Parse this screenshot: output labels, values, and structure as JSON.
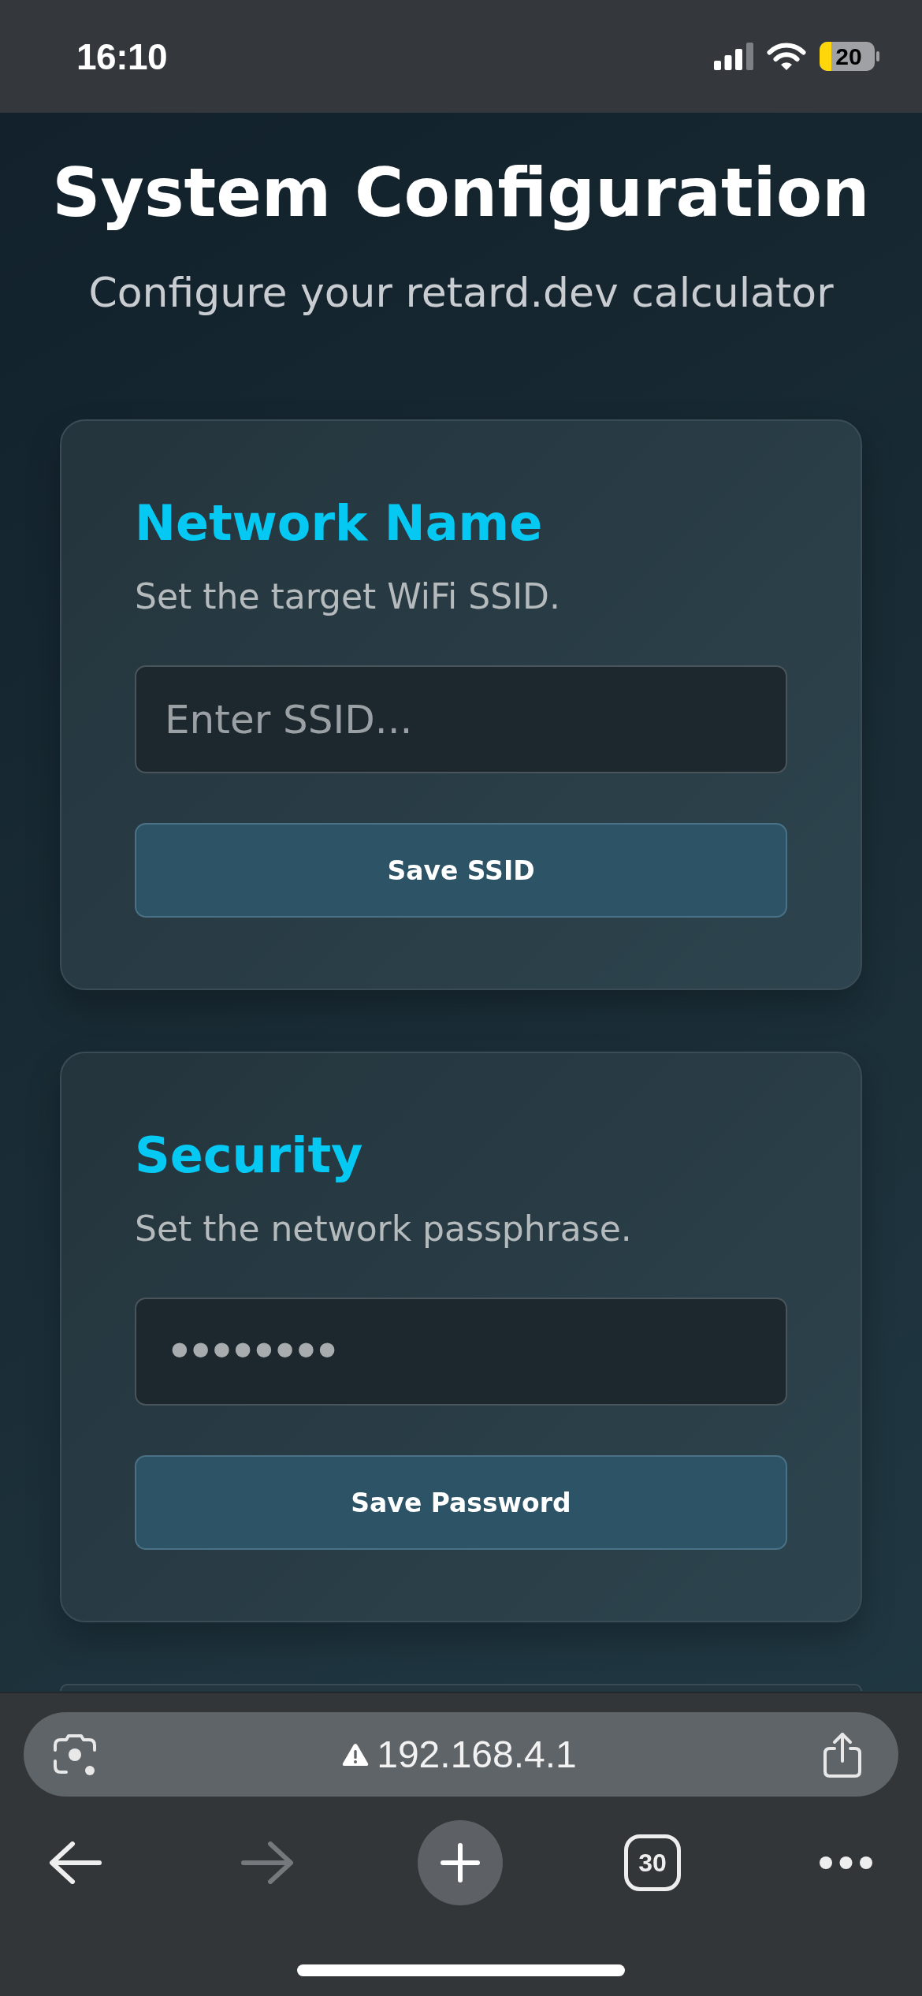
{
  "status_bar": {
    "time": "16:10",
    "battery": "20"
  },
  "header": {
    "title": "System Configuration",
    "subtitle": "Configure your retard.dev calculator"
  },
  "cards": [
    {
      "heading": "Network Name",
      "description": "Set the target WiFi SSID.",
      "field": {
        "kind": "text",
        "placeholder": "Enter SSID..."
      },
      "button": "Save SSID"
    },
    {
      "heading": "Security",
      "description": "Set the network passphrase.",
      "field": {
        "kind": "password",
        "value": "••••••••"
      },
      "button": "Save Password"
    }
  ],
  "browser": {
    "address": "192.168.4.1",
    "toolbar": [
      {
        "kind": "back",
        "disabled": false
      },
      {
        "kind": "forward",
        "disabled": true
      },
      {
        "kind": "new_tab",
        "disabled": false
      },
      {
        "kind": "tabs",
        "label": "30",
        "disabled": false
      },
      {
        "kind": "more",
        "disabled": false
      }
    ]
  }
}
